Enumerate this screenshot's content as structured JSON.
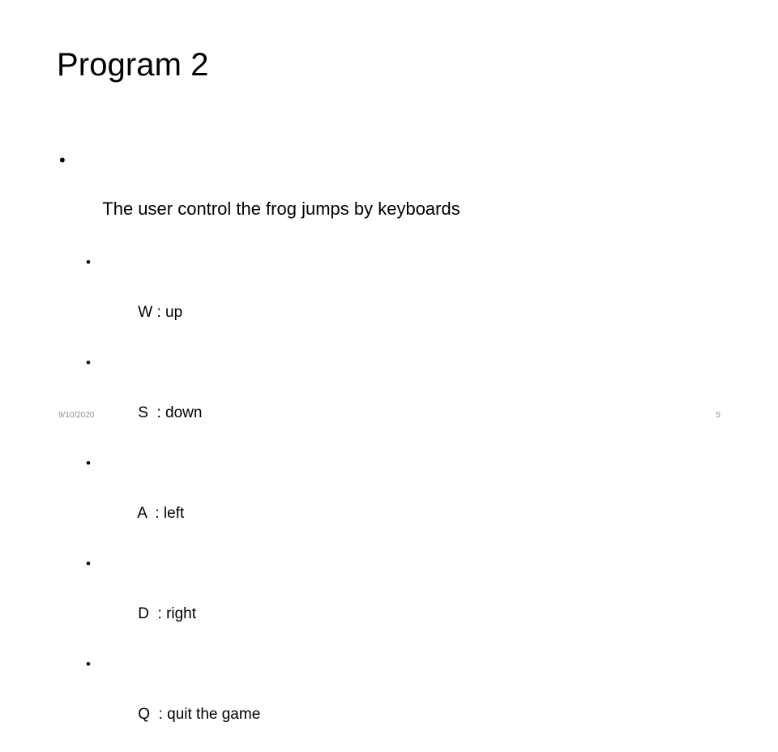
{
  "slide": {
    "title": "Program 2",
    "body": {
      "main_bullet": {
        "marker": "•",
        "text": "The user control the frog jumps by keyboards"
      },
      "sub_bullets": [
        {
          "marker": "•",
          "text": "W : up"
        },
        {
          "marker": "•",
          "text": "S  : down"
        },
        {
          "marker": "•",
          "text": "A  : left"
        },
        {
          "marker": "•",
          "text": "D  : right"
        },
        {
          "marker": "•",
          "text": "Q  : quit the game"
        }
      ]
    },
    "footer": {
      "date": "9/10/2020",
      "page_number": "5"
    }
  }
}
